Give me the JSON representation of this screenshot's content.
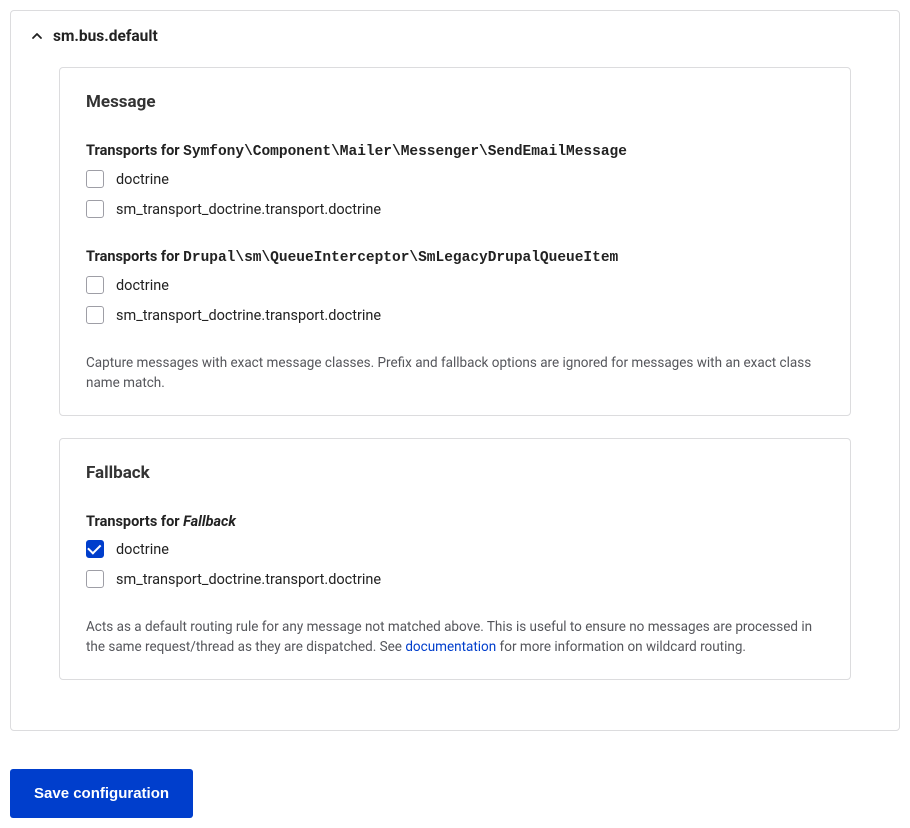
{
  "details": {
    "title": "sm.bus.default"
  },
  "fieldsets": {
    "message": {
      "legend": "Message",
      "sections": [
        {
          "transports_for_prefix": "Transports for ",
          "class_name": "Symfony\\Component\\Mailer\\Messenger\\SendEmailMessage",
          "options": [
            {
              "label": "doctrine",
              "checked": false
            },
            {
              "label": "sm_transport_doctrine.transport.doctrine",
              "checked": false
            }
          ]
        },
        {
          "transports_for_prefix": "Transports for ",
          "class_name": "Drupal\\sm\\QueueInterceptor\\SmLegacyDrupalQueueItem",
          "options": [
            {
              "label": "doctrine",
              "checked": false
            },
            {
              "label": "sm_transport_doctrine.transport.doctrine",
              "checked": false
            }
          ]
        }
      ],
      "description": "Capture messages with exact message classes. Prefix and fallback options are ignored for messages with an exact class name match."
    },
    "fallback": {
      "legend": "Fallback",
      "section": {
        "transports_for_prefix": "Transports for ",
        "label_italic": "Fallback",
        "options": [
          {
            "label": "doctrine",
            "checked": true
          },
          {
            "label": "sm_transport_doctrine.transport.doctrine",
            "checked": false
          }
        ]
      },
      "description_before_link": "Acts as a default routing rule for any message not matched above. This is useful to ensure no messages are processed in the same request/thread as they are dispatched. See ",
      "description_link": "documentation",
      "description_after_link": " for more information on wildcard routing."
    }
  },
  "save_button": "Save configuration"
}
